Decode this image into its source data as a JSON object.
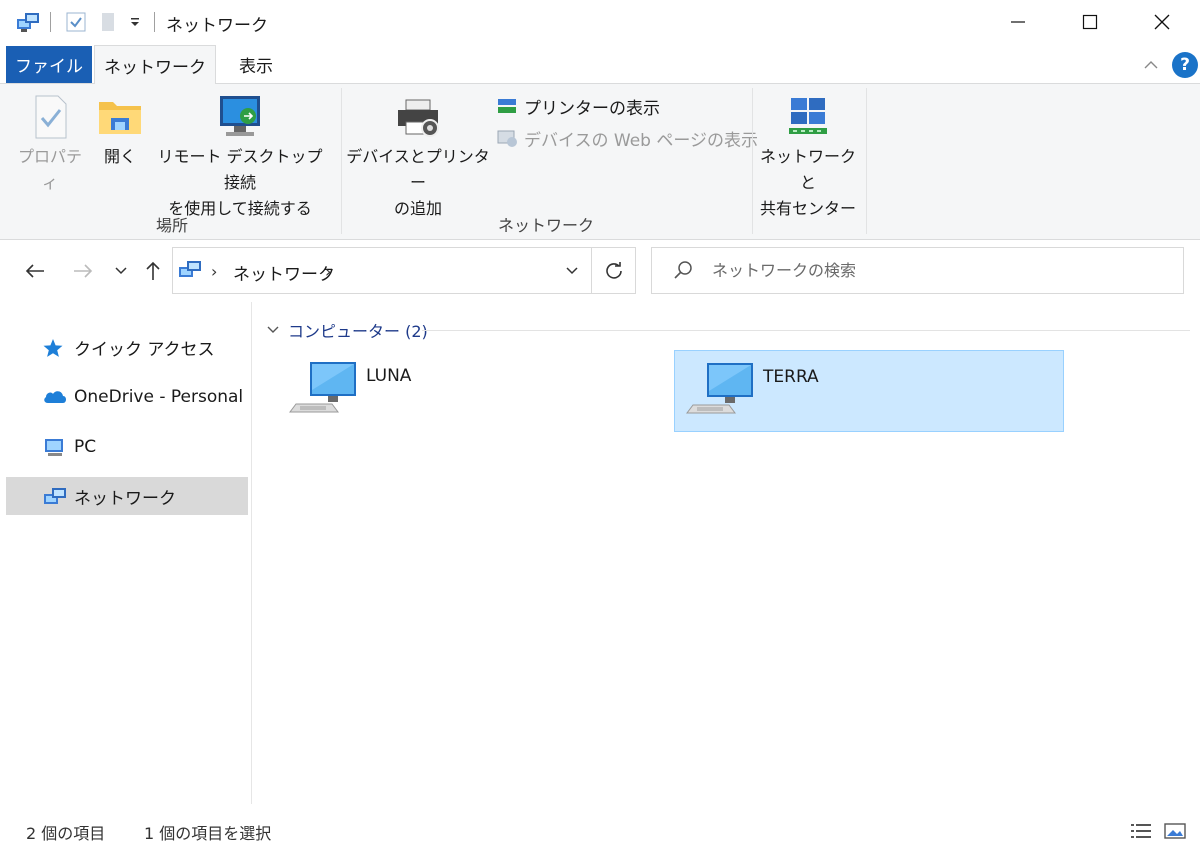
{
  "window": {
    "title": "ネットワーク",
    "buttons": {
      "minimize": "—",
      "maximize": "☐",
      "close": "✕"
    }
  },
  "ribbon_tabs": {
    "file": "ファイル",
    "network": "ネットワーク",
    "view": "表示"
  },
  "ribbon": {
    "location_group": {
      "label": "場所",
      "properties": "プロパティ",
      "open": "開く",
      "remote_desktop_line1": "リモート デスクトップ接続",
      "remote_desktop_line2": "を使用して接続する"
    },
    "network_group": {
      "label": "ネットワーク",
      "add_devices_line1": "デバイスとプリンター",
      "add_devices_line2": "の追加",
      "view_printers": "プリンターの表示",
      "view_device_web": "デバイスの Web ページの表示"
    },
    "sharing_center": {
      "line1": "ネットワークと",
      "line2": "共有センター"
    }
  },
  "address": {
    "current": "ネットワーク",
    "search_placeholder": "ネットワークの検索"
  },
  "nav_pane": {
    "items": [
      {
        "label": "クイック アクセス",
        "icon": "star-icon"
      },
      {
        "label": "OneDrive - Personal",
        "icon": "cloud-icon"
      },
      {
        "label": "PC",
        "icon": "pc-icon"
      },
      {
        "label": "ネットワーク",
        "icon": "network-icon",
        "selected": true
      }
    ]
  },
  "content": {
    "group_header": "コンピューター (2)",
    "items": [
      {
        "name": "LUNA",
        "selected": false
      },
      {
        "name": "TERRA",
        "selected": true
      }
    ]
  },
  "status": {
    "item_count": "2 個の項目",
    "selected_count": "1 個の項目を選択"
  },
  "colors": {
    "file_tab": "#1a5fb4",
    "selection_fill": "#cce8ff",
    "selection_border": "#99d1ff",
    "group_header": "#1e3a8a"
  }
}
